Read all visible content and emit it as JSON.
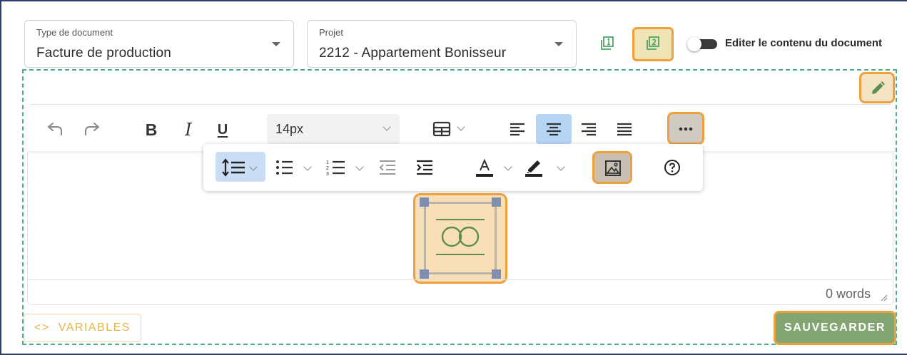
{
  "document_type": {
    "label": "Type de document",
    "value": "Facture de production"
  },
  "project": {
    "label": "Projet",
    "value": "2212 - Appartement Bonisseur"
  },
  "header": {
    "page_one_icon": "page-1-icon",
    "page_two_icon": "page-2-icon",
    "toggle_label": "Editer le contenu du document",
    "toggle_on": false
  },
  "toolbar": {
    "font_size": "14px",
    "bold_glyph": "B",
    "italic_glyph": "I",
    "underline_glyph": "U"
  },
  "editor": {
    "word_count": "0 words"
  },
  "footer": {
    "variables_label": "VARIABLES",
    "variables_glyph": "<>",
    "save_label": "SAUVEGARDER"
  },
  "colors": {
    "highlight": "#f0a03a",
    "dashed_border": "#4cae8a",
    "save": "#83a572",
    "variables": "#e3b548",
    "active_align": "#b6d5f5",
    "image_accent": "#5b8e4f"
  }
}
